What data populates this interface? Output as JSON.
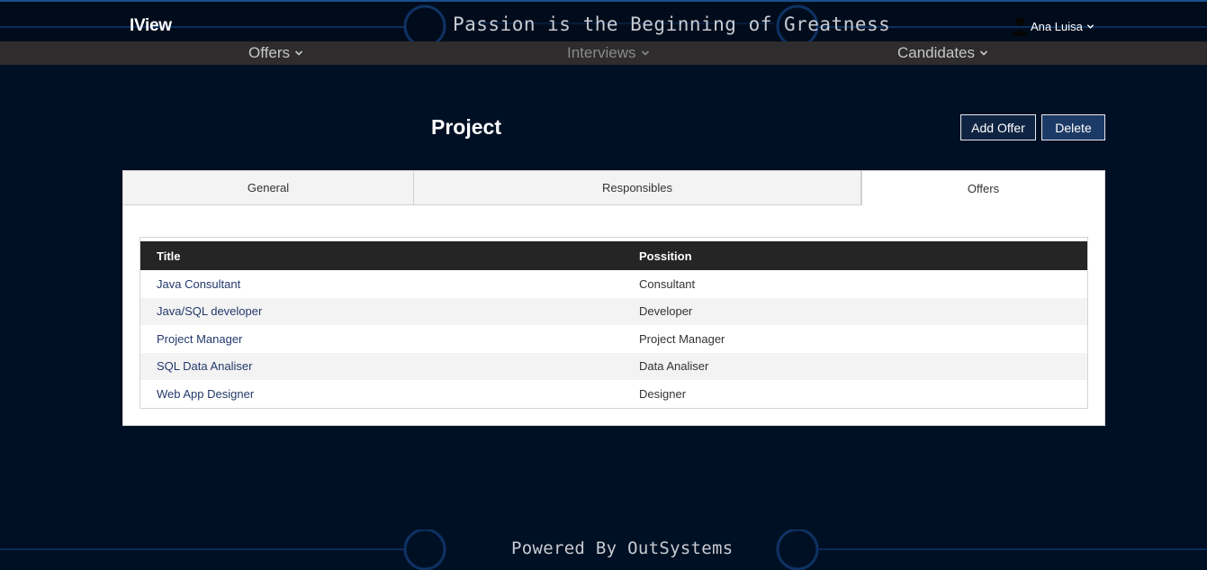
{
  "header": {
    "logo": "IView",
    "slogan": "Passion is the Beginning of Greatness",
    "user_name": "Ana Luisa"
  },
  "menu": {
    "items": [
      {
        "label": "Offers"
      },
      {
        "label": "Interviews"
      },
      {
        "label": "Candidates"
      }
    ]
  },
  "page": {
    "title": "Project",
    "add_offer_label": "Add Offer",
    "delete_label": "Delete"
  },
  "tabs": [
    {
      "label": "General"
    },
    {
      "label": "Responsibles"
    },
    {
      "label": "Offers"
    }
  ],
  "active_tab": "Offers",
  "offers_table": {
    "columns": [
      "Title",
      "Possition"
    ],
    "rows": [
      {
        "title": "Java Consultant",
        "position": "Consultant"
      },
      {
        "title": "Java/SQL developer",
        "position": "Developer"
      },
      {
        "title": "Project Manager",
        "position": "Project Manager"
      },
      {
        "title": "SQL Data Analiser",
        "position": "Data Analiser"
      },
      {
        "title": "Web App Designer",
        "position": "Designer"
      }
    ]
  },
  "footer": {
    "text": "Powered By OutSystems"
  },
  "colors": {
    "background": "#001024",
    "accent_line": "#1b4f8a",
    "menubar": "#2e2c2c",
    "table_header": "#252525",
    "link": "#23396b"
  }
}
